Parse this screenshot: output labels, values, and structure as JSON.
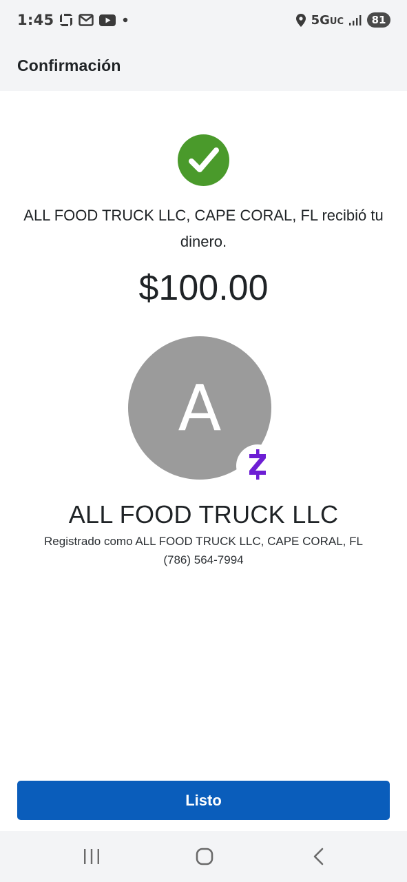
{
  "status_bar": {
    "time": "1:45",
    "network": "5G",
    "network_suffix": "UC",
    "battery": "81",
    "icons": [
      "chase-icon",
      "gmail-icon",
      "youtube-icon",
      "notification-dot-icon",
      "location-icon",
      "signal-icon"
    ]
  },
  "app_bar": {
    "title": "Confirmación"
  },
  "confirmation": {
    "icon": "check-circle-icon",
    "message": "ALL FOOD TRUCK LLC, CAPE CORAL, FL recibió tu dinero.",
    "amount": "$100.00"
  },
  "recipient": {
    "avatar_initial": "A",
    "badge_icon": "zelle-icon",
    "name": "ALL FOOD TRUCK LLC",
    "registered_as": "Registrado como ALL FOOD TRUCK LLC, CAPE CORAL, FL",
    "phone": "(786) 564-7994"
  },
  "actions": {
    "done_label": "Listo"
  },
  "nav_bar": {
    "icons": [
      "recents-icon",
      "home-icon",
      "back-icon"
    ]
  },
  "colors": {
    "success_green": "#4a9a2b",
    "primary_blue": "#0a5dbb",
    "zelle_purple": "#6d1ed4",
    "avatar_gray": "#9b9b9b",
    "bar_background": "#f3f4f6"
  }
}
